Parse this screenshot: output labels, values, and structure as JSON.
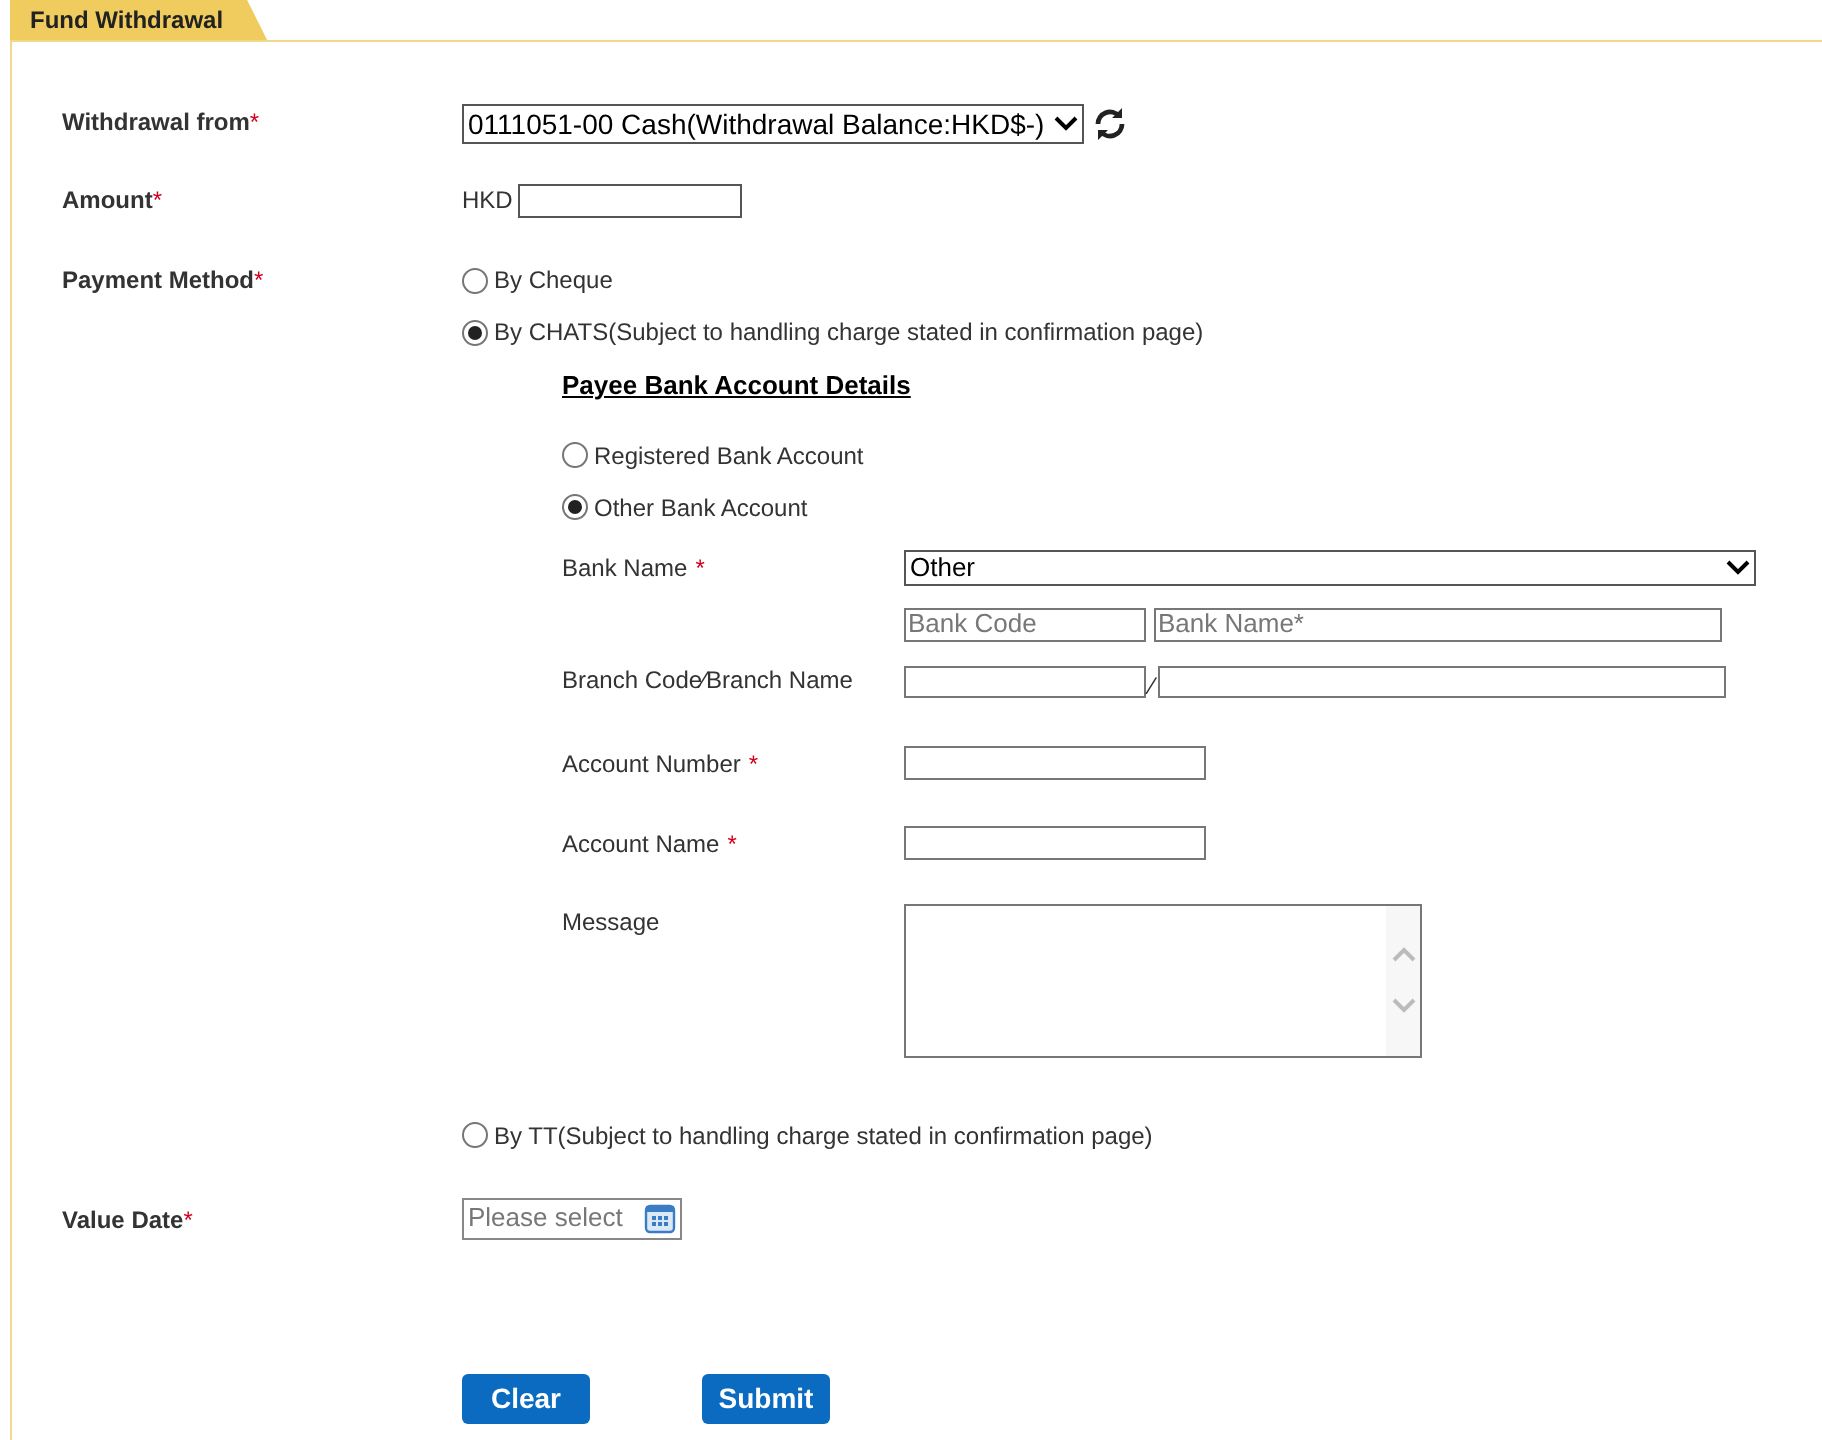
{
  "tab": {
    "label": "Fund Withdrawal"
  },
  "withdrawal_from": {
    "label": "Withdrawal from",
    "required_mark": "*",
    "value": "0111051-00 Cash(Withdrawal Balance:HKD$-)"
  },
  "amount": {
    "label": "Amount",
    "required_mark": "*",
    "currency": "HKD"
  },
  "payment_method": {
    "label": "Payment Method",
    "required_mark": "*",
    "options": [
      {
        "label": "By Cheque",
        "selected": false
      },
      {
        "label": "By CHATS(Subject to handling charge stated in confirmation page)",
        "selected": true
      },
      {
        "label": "By TT(Subject to handling charge stated in confirmation page)",
        "selected": false
      }
    ]
  },
  "payee_details": {
    "title": "Payee Bank Account Details",
    "account_types": [
      {
        "label": "Registered Bank Account",
        "selected": false
      },
      {
        "label": "Other Bank Account",
        "selected": true
      }
    ],
    "bank_name": {
      "label": "Bank Name",
      "required_mark": "*",
      "value": "Other",
      "code_placeholder": "Bank Code",
      "name_placeholder": "Bank Name*"
    },
    "branch": {
      "label": "Branch Code∕Branch Name",
      "separator": "∕"
    },
    "account_number": {
      "label": "Account Number",
      "required_mark": "*"
    },
    "account_name": {
      "label": "Account Name",
      "required_mark": "*"
    },
    "message": {
      "label": "Message"
    }
  },
  "value_date": {
    "label": "Value Date",
    "required_mark": "*",
    "placeholder": "Please select"
  },
  "buttons": [
    "Clear",
    "Submit"
  ]
}
